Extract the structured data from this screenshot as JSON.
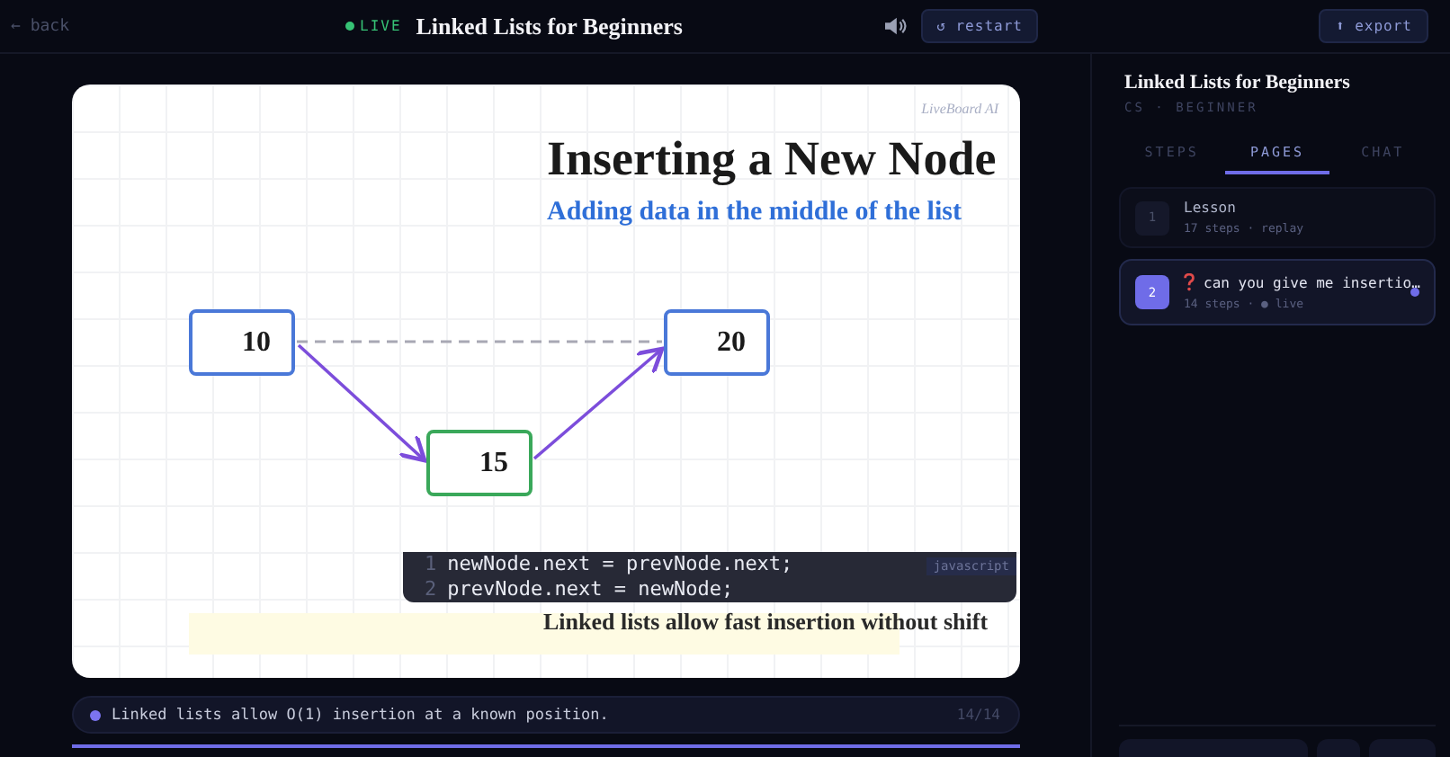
{
  "topbar": {
    "back": "← back",
    "live_label": "LIVE",
    "live": true,
    "title": "Linked Lists for Beginners",
    "restart": "↺ restart",
    "export": "⬆ export"
  },
  "slide": {
    "watermark": "LiveBoard AI",
    "title": "Inserting a New Node",
    "subtitle": "Adding data in the middle of the list",
    "nodes": [
      {
        "value": "10",
        "kind": "existing"
      },
      {
        "value": "20",
        "kind": "existing"
      },
      {
        "value": "15",
        "kind": "new"
      }
    ],
    "code": {
      "language": "javascript",
      "lines": [
        {
          "number": "1",
          "text": "newNode.next = prevNode.next;"
        },
        {
          "number": "2",
          "text": "prevNode.next = newNode;"
        }
      ]
    },
    "highlight_text": "Linked lists allow fast insertion without shift"
  },
  "caption": {
    "text": "Linked lists allow O(1) insertion at a known position.",
    "counter": "14/14"
  },
  "progress": {
    "level": 1
  },
  "sidebar": {
    "title": "Linked Lists for Beginners",
    "subtitle": "CS · BEGINNER",
    "tabs": [
      {
        "label": "STEPS",
        "selected": false
      },
      {
        "label": "PAGES",
        "selected": true
      },
      {
        "label": "CHAT",
        "selected": false
      }
    ],
    "pages": [
      {
        "number": "1",
        "title": "Lesson",
        "meta": "17 steps · replay",
        "selected": false,
        "question": false
      },
      {
        "number": "2",
        "title": "can you give me insertio…",
        "meta": "14 steps · ● live",
        "selected": true,
        "question": true
      }
    ]
  }
}
